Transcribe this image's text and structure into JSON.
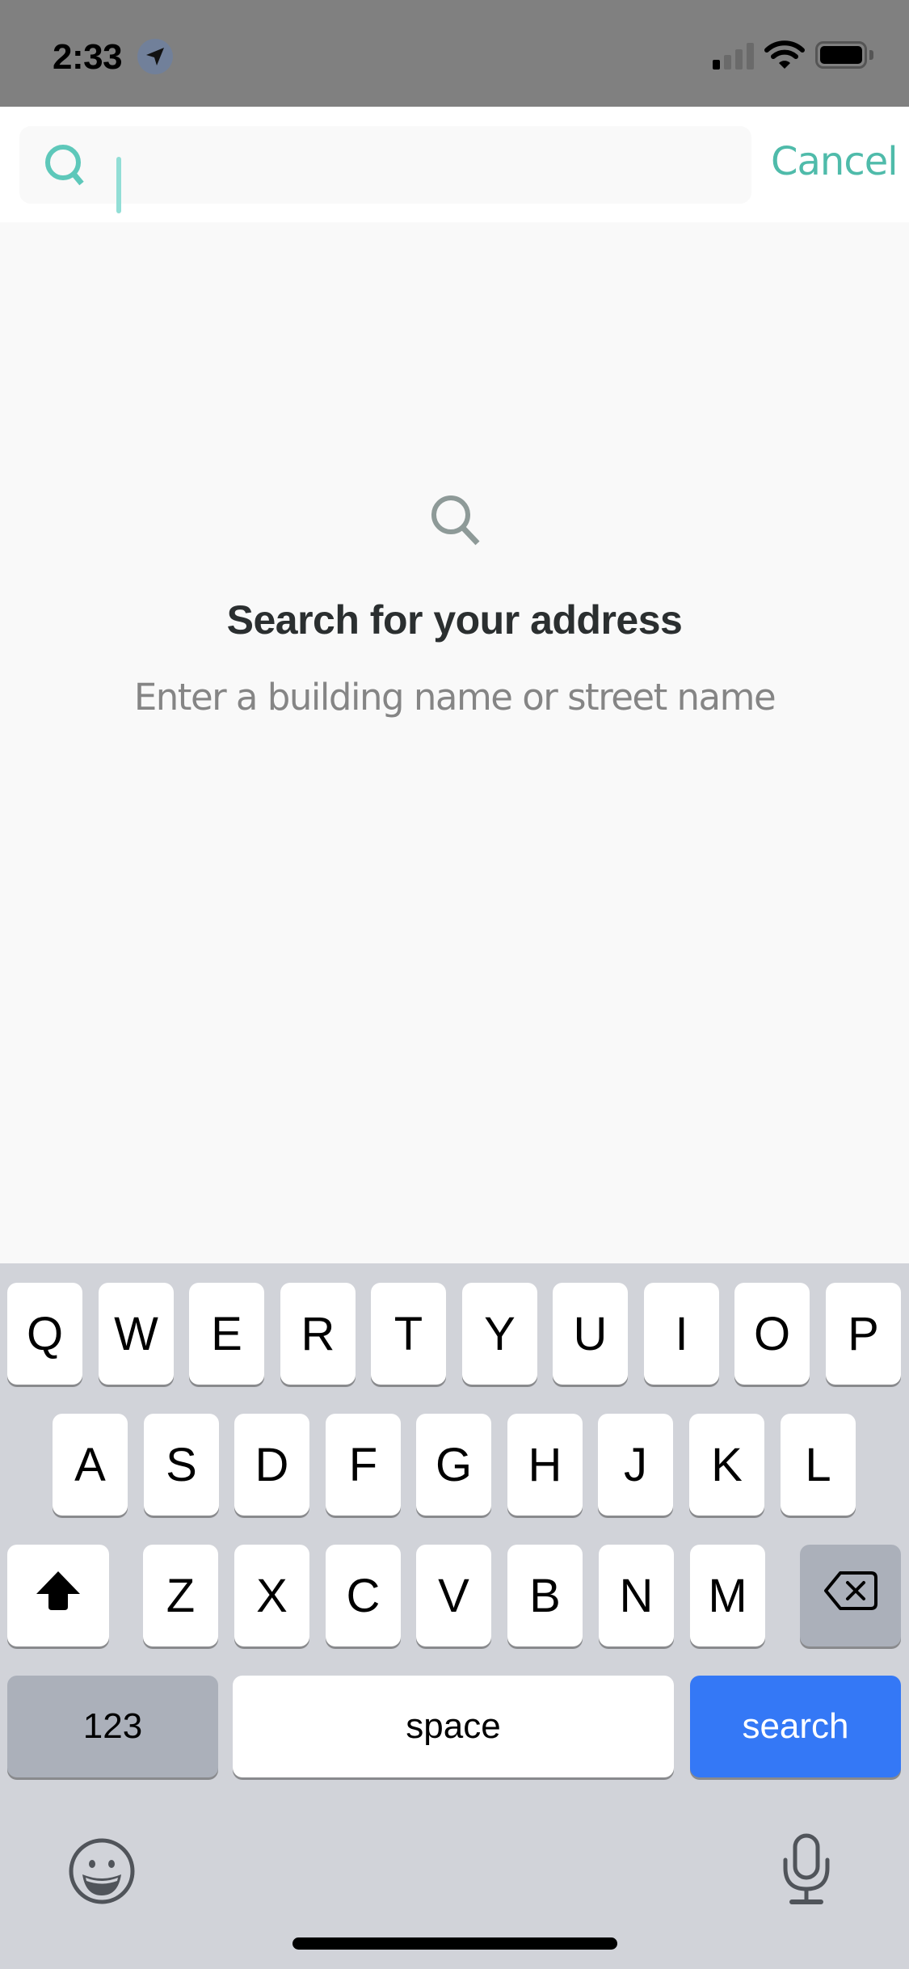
{
  "status_bar": {
    "time": "2:33",
    "icons": [
      "location-arrow-icon",
      "cellular-signal-icon",
      "wifi-icon",
      "battery-icon"
    ],
    "signal_bars_active": 1,
    "signal_bars_total": 4
  },
  "header": {
    "search": {
      "value": "",
      "placeholder": "",
      "icon": "search-icon"
    },
    "cancel_label": "Cancel"
  },
  "empty_state": {
    "icon": "search-icon",
    "title": "Search for your address",
    "subtitle": "Enter a building name or street name"
  },
  "keyboard": {
    "rows": [
      [
        "Q",
        "W",
        "E",
        "R",
        "T",
        "Y",
        "U",
        "I",
        "O",
        "P"
      ],
      [
        "A",
        "S",
        "D",
        "F",
        "G",
        "H",
        "J",
        "K",
        "L"
      ],
      [
        "Z",
        "X",
        "C",
        "V",
        "B",
        "N",
        "M"
      ]
    ],
    "shift_icon": "shift-arrow-icon",
    "delete_icon": "delete-backspace-icon",
    "numbers_label": "123",
    "space_label": "space",
    "return_label": "search",
    "emoji_icon": "emoji-icon",
    "dictation_icon": "microphone-icon"
  },
  "colors": {
    "accent": "#4FBBAA",
    "search_key": "#3478F6",
    "status_bar_bg": "#808080",
    "keyboard_bg": "#D1D3D9"
  }
}
